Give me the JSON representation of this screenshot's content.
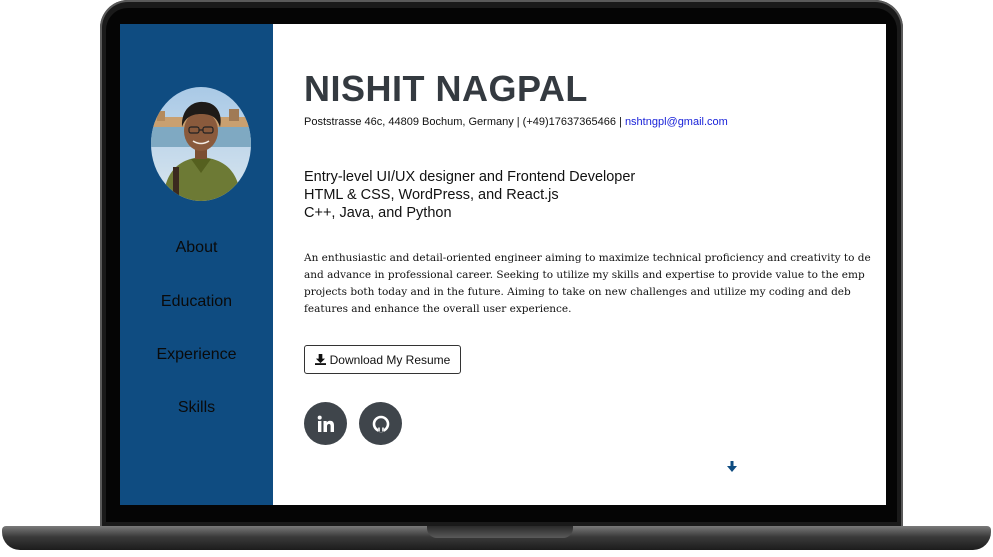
{
  "sidebar": {
    "nav": [
      "About",
      "Education",
      "Experience",
      "Skills"
    ]
  },
  "header": {
    "name": "NISHIT NAGPAL",
    "contact_text": "Poststrasse 46c, 44809 Bochum, Germany | (+49)17637365466 | ",
    "email": "nshtngpl@gmail.com"
  },
  "tagline": [
    "Entry-level UI/UX designer and Frontend Developer",
    "HTML & CSS, WordPress, and React.js",
    "C++, Java, and Python"
  ],
  "summary": [
    "An enthusiastic and detail-oriented engineer aiming to maximize technical proficiency and creativity to de",
    "and advance in professional career. Seeking to utilize my skills and expertise to provide value to the emp",
    "projects both today and in the future. Aiming to take on new challenges and utilize my coding and deb",
    "features and enhance the overall user experience."
  ],
  "resume_button": "Download My Resume",
  "icons": {
    "download": "download-icon",
    "linkedin": "linkedin-icon",
    "github": "github-icon",
    "scroll": "arrow-down-icon"
  },
  "colors": {
    "sidebar": "#0f4c81",
    "heading": "#343a40",
    "link": "#1a23d9",
    "social_bg": "#3f454b"
  }
}
